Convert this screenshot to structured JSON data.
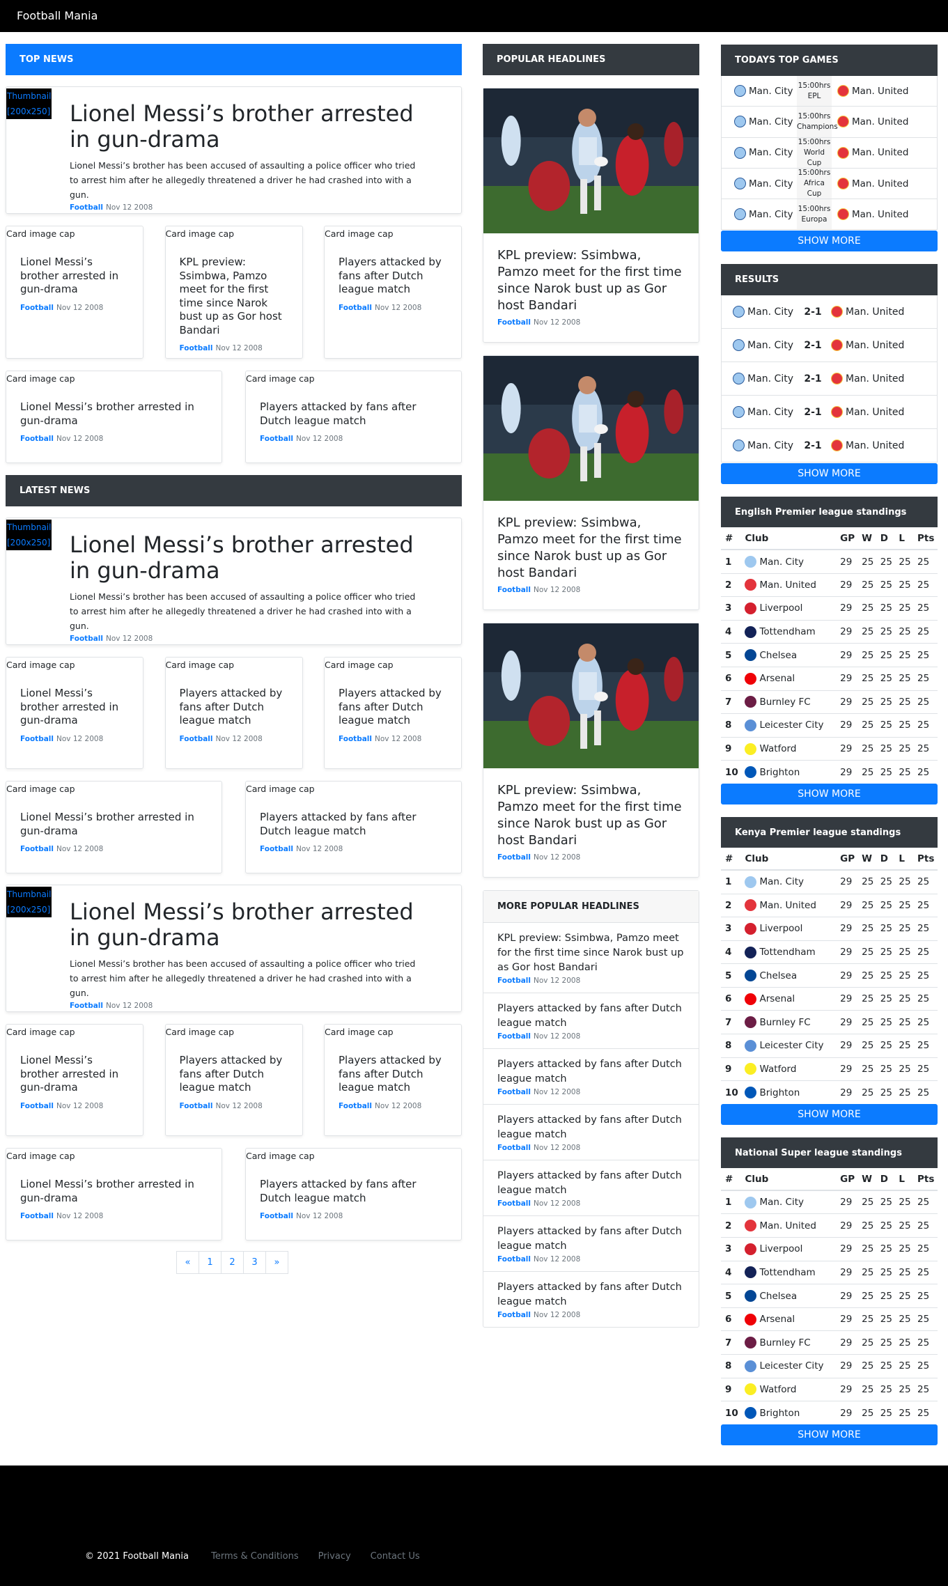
{
  "brand": "Football Mania",
  "top_news": {
    "title": "TOP NEWS",
    "feature": {
      "thumb": "Thumbnail [200x250]",
      "headline": "Lionel Messi’s brother arrested in gun-drama",
      "summary": "Lionel Messi’s brother has been accused of assaulting a police officer who tried to arrest him after he allegedly threatened a driver he had crashed into with a gun.",
      "category": "Football",
      "date": "Nov 12 2008"
    },
    "row1": [
      {
        "cap": "Card image cap",
        "title": "Lionel Messi’s brother arrested in gun-drama",
        "category": "Football",
        "date": "Nov 12 2008"
      },
      {
        "cap": "Card image cap",
        "title": "KPL preview: Ssimbwa, Pamzo meet for the first time since Narok bust up as Gor host Bandari",
        "category": "Football",
        "date": "Nov 12 2008"
      },
      {
        "cap": "Card image cap",
        "title": "Players attacked by fans after Dutch league match",
        "category": "Football",
        "date": "Nov 12 2008"
      }
    ],
    "row2": [
      {
        "cap": "Card image cap",
        "title": "Lionel Messi’s brother arrested in gun-drama",
        "category": "Football",
        "date": "Nov 12 2008"
      },
      {
        "cap": "Card image cap",
        "title": "Players attacked by fans after Dutch league match",
        "category": "Football",
        "date": "Nov 12 2008"
      }
    ]
  },
  "latest_news": {
    "title": "LATEST NEWS",
    "blocks": [
      {
        "feature": {
          "thumb": "Thumbnail [200x250]",
          "headline": "Lionel Messi’s brother arrested in gun-drama",
          "summary": "Lionel Messi’s brother has been accused of assaulting a police officer who tried to arrest him after he allegedly threatened a driver he had crashed into with a gun.",
          "category": "Football",
          "date": "Nov 12 2008"
        },
        "row1": [
          {
            "cap": "Card image cap",
            "title": "Lionel Messi’s brother arrested in gun-drama",
            "category": "Football",
            "date": "Nov 12 2008"
          },
          {
            "cap": "Card image cap",
            "title": "Players attacked by fans after Dutch league match",
            "category": "Football",
            "date": "Nov 12 2008"
          },
          {
            "cap": "Card image cap",
            "title": "Players attacked by fans after Dutch league match",
            "category": "Football",
            "date": "Nov 12 2008"
          }
        ],
        "row2": [
          {
            "cap": "Card image cap",
            "title": "Lionel Messi’s brother arrested in gun-drama",
            "category": "Football",
            "date": "Nov 12 2008"
          },
          {
            "cap": "Card image cap",
            "title": "Players attacked by fans after Dutch league match",
            "category": "Football",
            "date": "Nov 12 2008"
          }
        ]
      },
      {
        "feature": {
          "thumb": "Thumbnail [200x250]",
          "headline": "Lionel Messi’s brother arrested in gun-drama",
          "summary": "Lionel Messi’s brother has been accused of assaulting a police officer who tried to arrest him after he allegedly threatened a driver he had crashed into with a gun.",
          "category": "Football",
          "date": "Nov 12 2008"
        },
        "row1": [
          {
            "cap": "Card image cap",
            "title": "Lionel Messi’s brother arrested in gun-drama",
            "category": "Football",
            "date": "Nov 12 2008"
          },
          {
            "cap": "Card image cap",
            "title": "Players attacked by fans after Dutch league match",
            "category": "Football",
            "date": "Nov 12 2008"
          },
          {
            "cap": "Card image cap",
            "title": "Players attacked by fans after Dutch league match",
            "category": "Football",
            "date": "Nov 12 2008"
          }
        ],
        "row2": [
          {
            "cap": "Card image cap",
            "title": "Lionel Messi’s brother arrested in gun-drama",
            "category": "Football",
            "date": "Nov 12 2008"
          },
          {
            "cap": "Card image cap",
            "title": "Players attacked by fans after Dutch league match",
            "category": "Football",
            "date": "Nov 12 2008"
          }
        ]
      }
    ]
  },
  "pagination": [
    "«",
    "1",
    "2",
    "3",
    "»"
  ],
  "popular": {
    "title": "POPULAR HEADLINES",
    "items": [
      {
        "title": "KPL preview: Ssimbwa, Pamzo meet for the first time since Narok bust up as Gor host Bandari",
        "category": "Football",
        "date": "Nov 12 2008"
      },
      {
        "title": "KPL preview: Ssimbwa, Pamzo meet for the first time since Narok bust up as Gor host Bandari",
        "category": "Football",
        "date": "Nov 12 2008"
      },
      {
        "title": "KPL preview: Ssimbwa, Pamzo meet for the first time since Narok bust up as Gor host Bandari",
        "category": "Football",
        "date": "Nov 12 2008"
      }
    ]
  },
  "more_popular": {
    "title": "MORE POPULAR HEADLINES",
    "items": [
      {
        "title": "KPL preview: Ssimbwa, Pamzo meet for the first time since Narok bust up as Gor host Bandari",
        "category": "Football",
        "date": "Nov 12 2008"
      },
      {
        "title": "Players attacked by fans after Dutch league match",
        "category": "Football",
        "date": "Nov 12 2008"
      },
      {
        "title": "Players attacked by fans after Dutch league match",
        "category": "Football",
        "date": "Nov 12 2008"
      },
      {
        "title": "Players attacked by fans after Dutch league match",
        "category": "Football",
        "date": "Nov 12 2008"
      },
      {
        "title": "Players attacked by fans after Dutch league match",
        "category": "Football",
        "date": "Nov 12 2008"
      },
      {
        "title": "Players attacked by fans after Dutch league match",
        "category": "Football",
        "date": "Nov 12 2008"
      },
      {
        "title": "Players attacked by fans after Dutch league match",
        "category": "Football",
        "date": "Nov 12 2008"
      }
    ]
  },
  "top_games": {
    "title": "TODAYS TOP GAMES",
    "games": [
      {
        "home": "Man. City",
        "time": "15:00hrs",
        "comp": "EPL",
        "away": "Man. United"
      },
      {
        "home": "Man. City",
        "time": "15:00hrs",
        "comp": "Champions",
        "away": "Man. United"
      },
      {
        "home": "Man. City",
        "time": "15:00hrs",
        "comp": "World Cup",
        "away": "Man. United"
      },
      {
        "home": "Man. City",
        "time": "15:00hrs",
        "comp": "Africa Cup",
        "away": "Man. United"
      },
      {
        "home": "Man. City",
        "time": "15:00hrs",
        "comp": "Europa",
        "away": "Man. United"
      }
    ],
    "button": "SHOW MORE"
  },
  "results": {
    "title": "RESULTS",
    "games": [
      {
        "home": "Man. City",
        "score": "2-1",
        "away": "Man. United"
      },
      {
        "home": "Man. City",
        "score": "2-1",
        "away": "Man. United"
      },
      {
        "home": "Man. City",
        "score": "2-1",
        "away": "Man. United"
      },
      {
        "home": "Man. City",
        "score": "2-1",
        "away": "Man. United"
      },
      {
        "home": "Man. City",
        "score": "2-1",
        "away": "Man. United"
      }
    ],
    "button": "SHOW MORE"
  },
  "standings_headers": [
    "#",
    "Club",
    "GP",
    "W",
    "D",
    "L",
    "Pts"
  ],
  "standings": [
    {
      "title": "English Premier league standings",
      "button": "SHOW MORE"
    },
    {
      "title": "Kenya Premier league standings",
      "button": "SHOW MORE"
    },
    {
      "title": "National Super league standings",
      "button": "SHOW MORE"
    }
  ],
  "standings_rows": [
    {
      "pos": "1",
      "club": "Man. City",
      "color": "#9ec8ef",
      "gp": "29",
      "w": "25",
      "d": "25",
      "l": "25",
      "pts": "25"
    },
    {
      "pos": "2",
      "club": "Man. United",
      "color": "#e3343c",
      "gp": "29",
      "w": "25",
      "d": "25",
      "l": "25",
      "pts": "25"
    },
    {
      "pos": "3",
      "club": "Liverpool",
      "color": "#d4202e",
      "gp": "29",
      "w": "25",
      "d": "25",
      "l": "25",
      "pts": "25"
    },
    {
      "pos": "4",
      "club": "Tottendham",
      "color": "#132257",
      "gp": "29",
      "w": "25",
      "d": "25",
      "l": "25",
      "pts": "25"
    },
    {
      "pos": "5",
      "club": "Chelsea",
      "color": "#034694",
      "gp": "29",
      "w": "25",
      "d": "25",
      "l": "25",
      "pts": "25"
    },
    {
      "pos": "6",
      "club": "Arsenal",
      "color": "#ef0107",
      "gp": "29",
      "w": "25",
      "d": "25",
      "l": "25",
      "pts": "25"
    },
    {
      "pos": "7",
      "club": "Burnley FC",
      "color": "#6c1d45",
      "gp": "29",
      "w": "25",
      "d": "25",
      "l": "25",
      "pts": "25"
    },
    {
      "pos": "8",
      "club": "Leicester City",
      "color": "#5a8fd6",
      "gp": "29",
      "w": "25",
      "d": "25",
      "l": "25",
      "pts": "25"
    },
    {
      "pos": "9",
      "club": "Watford",
      "color": "#fbee23",
      "gp": "29",
      "w": "25",
      "d": "25",
      "l": "25",
      "pts": "25"
    },
    {
      "pos": "10",
      "club": "Brighton",
      "color": "#0057b8",
      "gp": "29",
      "w": "25",
      "d": "25",
      "l": "25",
      "pts": "25"
    }
  ],
  "footer": {
    "copyright": "© 2021 Football Mania",
    "links": [
      "Terms & Conditions",
      "Privacy",
      "Contact Us"
    ]
  },
  "colors": {
    "accent": "#0b7bff",
    "dark": "#343a40",
    "navbar": "#000000"
  }
}
